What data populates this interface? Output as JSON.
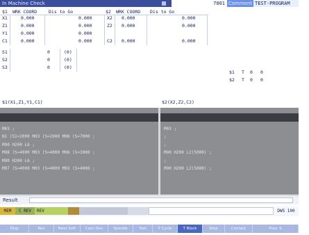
{
  "title_bar": {
    "title": "In Machine Check",
    "prog_number": "7001",
    "comment_label": "Comment",
    "program_name": "TEST-PROGRAM"
  },
  "coord_table": {
    "left_headers": [
      "$1",
      "WRK COORD",
      "Dis to Go"
    ],
    "right_headers": [
      "$2",
      "WRK COORD",
      "Dis to Go"
    ],
    "left_rows": [
      {
        "axis": "X1",
        "coord": "0.000",
        "dist": "0.000"
      },
      {
        "axis": "Z1",
        "coord": "0.000",
        "dist": "0.000"
      },
      {
        "axis": "Y1",
        "coord": "0.000",
        "dist": "0.000"
      },
      {
        "axis": "C1",
        "coord": "0.000",
        "dist": "0.000"
      }
    ],
    "right_rows": [
      {
        "axis": "X2",
        "coord": "0.000",
        "dist": "0.000"
      },
      {
        "axis": "Z2",
        "coord": "0.000",
        "dist": "0.000"
      },
      {
        "axis": "",
        "coord": "",
        "dist": ""
      },
      {
        "axis": "C2",
        "coord": "0.000",
        "dist": "0.000"
      }
    ]
  },
  "spindles": [
    {
      "name": "S1",
      "value": "0",
      "unit": "(0)"
    },
    {
      "name": "S2",
      "value": "0",
      "unit": "(0)"
    },
    {
      "name": "S3",
      "value": "0",
      "unit": "(0)"
    }
  ],
  "tools": [
    {
      "name": "$1",
      "t": "T",
      "a": "0",
      "b": "0"
    },
    {
      "name": "$2",
      "t": "T",
      "a": "0",
      "b": "0"
    }
  ],
  "axis_labels": {
    "left": "$1(X1,Z1,Y1,C1)",
    "right": "$2(X2,Z2,C2)"
  },
  "program_left": [
    "M03 ;",
    "N1 (S1=2000 M03 (S=2000 M08 (S=7000 ;",
    "M90 H200 L6 ;",
    "M98 (S=4000 M03 (S=4000 M08 (S=3000 ;",
    "M90 H200 L6 ;",
    "M97 (S=4000 M03 (S=4000 M03 (S=4000 ;"
  ],
  "program_right": [
    "M03 ;",
    ";",
    ";",
    "M90 H200 L2(5000) ;",
    ";",
    "M90 H200 L2(5000) ;"
  ],
  "result": {
    "label": "Result"
  },
  "status": {
    "mode": "MEM",
    "c_rev": "C REV",
    "rev": "REV",
    "right_text": "DWS 100"
  },
  "softkeys": [
    "Disp",
    "Rev",
    "Next Soft",
    "Coor Dev",
    "Spindle",
    "Tool",
    "T Cycle",
    "T Block",
    "Stop",
    "Contact",
    "Prev. S"
  ]
}
